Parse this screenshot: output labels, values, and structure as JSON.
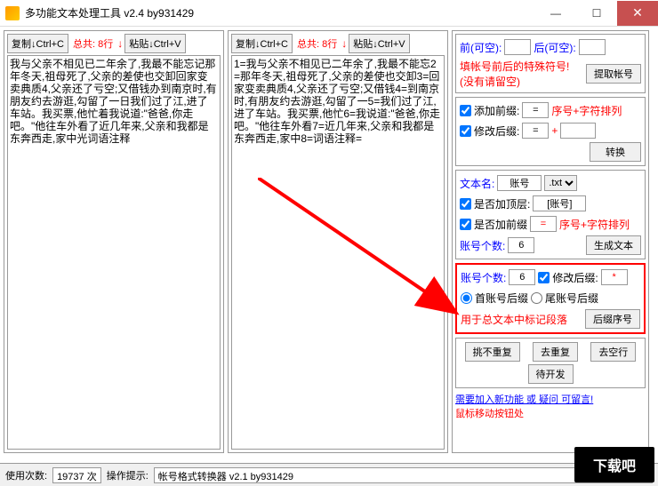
{
  "window": {
    "title": "多功能文本处理工具 v2.4 by931429",
    "min": "—",
    "max": "☐",
    "close": "✕"
  },
  "left": {
    "copy": "复制↓Ctrl+C",
    "total": "总共: 8行",
    "paste": "粘贴↓Ctrl+V",
    "text": "我与父亲不相见已二年余了,我最不能忘记那年冬天,祖母死了,父亲的差使也交卸回家变卖典质4,父亲还了亏空;又借钱办到南京时,有朋友约去游逛,勾留了一日我们过了江,进了车站。我买票,他忙着我说道:\"爸爸,你走吧。\"他往车外看了近几年来,父亲和我都是东奔西走,家中光词语注释"
  },
  "mid": {
    "copy": "复制↓Ctrl+C",
    "total": "总共: 8行",
    "paste": "粘贴↓Ctrl+V",
    "text": "1=我与父亲不相见已二年余了,我最不能忘2=那年冬天,祖母死了,父亲的差使也交卸3=回家变卖典质4,父亲还了亏空;又借钱4=到南京时,有朋友约去游逛,勾留了一5=我们过了江,进了车站。我买票,他忙6=我说道:\"爸爸,你走吧。\"他往车外看7=近几年来,父亲和我都是东奔西走,家中8=词语注释="
  },
  "right": {
    "s1": {
      "front": "前(可空):",
      "back": "后(可空):",
      "note1": "填帐号前后的特殊符号!",
      "note2": "(没有请留空)",
      "btn": "提取帐号"
    },
    "s2": {
      "addPrefix": "添加前缀:",
      "modSuffix": "修改后缀:",
      "eq": "=",
      "plus": "+",
      "seqLabel": "序号+字符排列",
      "btn": "转换"
    },
    "s3": {
      "filename": "文本名:",
      "filenameVal": "账号",
      "ext": ".txt",
      "addTop": "是否加顶层:",
      "topVal": "[账号]",
      "addPrefix": "是否加前缀",
      "eq": "=",
      "seqLabel": "序号+字符排列",
      "count": "账号个数:",
      "countVal": "6",
      "btn": "生成文本"
    },
    "s4": {
      "count": "账号个数:",
      "countVal": "6",
      "modSuffix": "修改后缀:",
      "star": "*",
      "firstSuffix": "首账号后缀",
      "lastSuffix": "尾账号后缀",
      "note": "用于总文本中标记段落",
      "btn": "后缀序号"
    },
    "s5": {
      "b1": "挑不重复",
      "b2": "去重复",
      "b3": "去空行",
      "b4": "待开发"
    },
    "notes": {
      "n1": "需要加入新功能 或 疑问 可留言!",
      "n2": "鼠标移动按钮处"
    }
  },
  "status": {
    "useCount": "使用次数:",
    "useCountVal": "19737 次",
    "hint": "操作提示:",
    "hintVal": "帐号格式转换器 v2.1 by931429"
  },
  "badge": "下载吧"
}
